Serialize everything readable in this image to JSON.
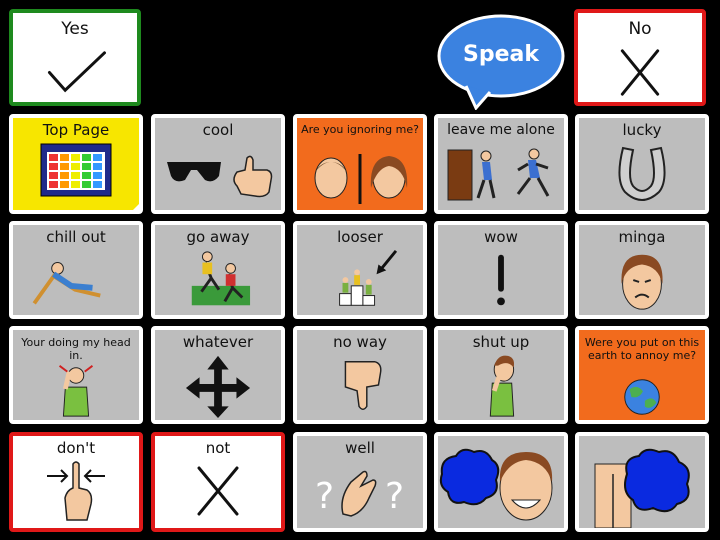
{
  "yes_label": "Yes",
  "no_label": "No",
  "speak_label": "Speak",
  "tiles": [
    {
      "label": "Top Page",
      "icon": "grid-page-icon"
    },
    {
      "label": "cool",
      "icon": "sunglasses-thumbsup-icon"
    },
    {
      "label": "Are you ignoring me?",
      "icon": "two-faces-icon"
    },
    {
      "label": "leave me alone",
      "icon": "door-walking-icon"
    },
    {
      "label": "lucky",
      "icon": "horseshoe-icon"
    },
    {
      "label": "chill out",
      "icon": "deckchair-icon"
    },
    {
      "label": "go away",
      "icon": "runners-icon"
    },
    {
      "label": "looser",
      "icon": "podium-icon"
    },
    {
      "label": "wow",
      "icon": "exclamation-icon"
    },
    {
      "label": "minga",
      "icon": "disgusted-face-icon"
    },
    {
      "label": "Your doing my head in.",
      "icon": "headache-icon"
    },
    {
      "label": "whatever",
      "icon": "four-arrows-icon"
    },
    {
      "label": "no way",
      "icon": "thumbs-down-icon"
    },
    {
      "label": "shut up",
      "icon": "finger-lips-icon"
    },
    {
      "label": "Were you put on this earth to annoy me?",
      "icon": "earth-icon"
    },
    {
      "label": "don't",
      "icon": "finger-arrows-icon"
    },
    {
      "label": "not",
      "icon": "cross-icon"
    },
    {
      "label": "well",
      "icon": "hand-question-icon"
    },
    {
      "label": "",
      "icon": "laughing-face-icon"
    },
    {
      "label": "",
      "icon": "bottom-icon"
    }
  ]
}
